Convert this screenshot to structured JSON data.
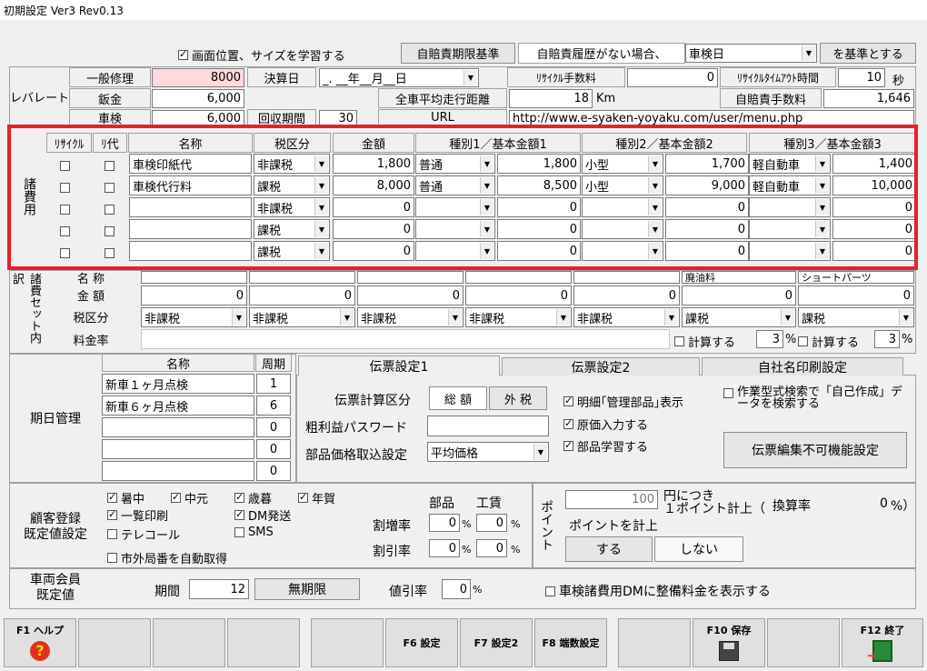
{
  "window": {
    "title": "初期設定 Ver3 Rev0.13"
  },
  "top": {
    "learn_checkbox": "画面位置、サイズを学習する",
    "jibai_button": "自賠責期限基準",
    "jibai_cond": "自賠責履歴がない場合、",
    "jibai_select": "車検日",
    "jibai_suffix": "を基準とする"
  },
  "rate": {
    "label": "レバレート",
    "rows": [
      {
        "name": "一般修理",
        "value": "8000"
      },
      {
        "name": "鈑金",
        "value": "6,000"
      },
      {
        "name": "車検",
        "value": "6,000"
      }
    ],
    "kessan_label": "決算日",
    "kessan_value": "_. __年__月__日",
    "kaishu_label": "回収期間",
    "kaishu_value": "30",
    "recycle_fee_label": "ﾘｻｲｸﾙ手数料",
    "recycle_fee_value": "0",
    "recycle_timeout_label": "ﾘｻｲｸﾙﾀｲﾑｱｳﾄ時間",
    "recycle_timeout_value": "10",
    "recycle_timeout_unit": "秒",
    "mileage_label": "全車平均走行距離",
    "mileage_value": "18",
    "mileage_unit": "Km",
    "jibai_fee_label": "自賠責手数料",
    "jibai_fee_value": "1,646",
    "url_label": "URL",
    "url_value": "http://www.e-syaken-yoyaku.com/user/menu.php"
  },
  "fees": {
    "side_label": "諸費用",
    "headers": [
      "ﾘｻｲｸﾙ",
      "ﾘ代",
      "名称",
      "税区分",
      "金額",
      "種別1／基本金額1",
      "種別2／基本金額2",
      "種別3／基本金額3"
    ],
    "rows": [
      {
        "name": "車検印紙代",
        "tax": "非課税",
        "amount": "1,800",
        "t1": "普通",
        "a1": "1,800",
        "t2": "小型",
        "a2": "1,700",
        "t3": "軽自動車",
        "a3": "1,400"
      },
      {
        "name": "車検代行料",
        "tax": "課税",
        "amount": "8,000",
        "t1": "普通",
        "a1": "8,500",
        "t2": "小型",
        "a2": "9,000",
        "t3": "軽自動車",
        "a3": "10,000"
      },
      {
        "name": "",
        "tax": "非課税",
        "amount": "0",
        "t1": "",
        "a1": "0",
        "t2": "",
        "a2": "0",
        "t3": "",
        "a3": "0"
      },
      {
        "name": "",
        "tax": "課税",
        "amount": "0",
        "t1": "",
        "a1": "0",
        "t2": "",
        "a2": "0",
        "t3": "",
        "a3": "0"
      },
      {
        "name": "",
        "tax": "課税",
        "amount": "0",
        "t1": "",
        "a1": "0",
        "t2": "",
        "a2": "0",
        "t3": "",
        "a3": "0"
      }
    ]
  },
  "set": {
    "side_label": "諸費セット内訳",
    "name_label": "名 称",
    "amount_label": "金 額",
    "tax_label": "税区分",
    "rate_label": "料金率",
    "names": [
      "",
      "",
      "",
      "",
      "",
      "",
      "",
      "ショートパーツ"
    ],
    "extra_name": "廃油料",
    "amounts": [
      "0",
      "0",
      "0",
      "0",
      "0",
      "0",
      "0"
    ],
    "taxes": [
      "非課税",
      "非課税",
      "非課税",
      "非課税",
      "非課税",
      "課税",
      "課税"
    ],
    "calc1": "計算する",
    "calc1_val": "3",
    "calc2": "計算する",
    "calc2_val": "3",
    "pct": "%"
  },
  "kijitsu": {
    "label": "期日管理",
    "name_header": "名称",
    "period_header": "周期",
    "rows": [
      {
        "name": "新車１ヶ月点検",
        "period": "1"
      },
      {
        "name": "新車６ヶ月点検",
        "period": "6"
      },
      {
        "name": "",
        "period": "0"
      },
      {
        "name": "",
        "period": "0"
      },
      {
        "name": "",
        "period": "0"
      }
    ]
  },
  "tabs": {
    "t1": "伝票設定1",
    "t2": "伝票設定2",
    "t3": "自社名印刷設定"
  },
  "denpyo": {
    "calc_label": "伝票計算区分",
    "calc_opt1": "総 額",
    "calc_opt2": "外 税",
    "pw_label": "粗利益パスワード",
    "parts_label": "部品価格取込設定",
    "parts_value": "平均価格",
    "cb1": "明細｢管理部品｣表示",
    "cb2": "原価入力する",
    "cb3": "部品学習する",
    "cb4": "作業型式検索で「自己作成」データを検索する",
    "edit_btn": "伝票編集不可機能設定"
  },
  "customer": {
    "label": "顧客登録\n既定値設定",
    "cbs": [
      {
        "t": "暑中",
        "on": true
      },
      {
        "t": "中元",
        "on": true
      },
      {
        "t": "歳暮",
        "on": true
      },
      {
        "t": "年賀",
        "on": true
      },
      {
        "t": "一覧印刷",
        "on": true
      },
      {
        "t": "DM発送",
        "on": true
      },
      {
        "t": "テレコール",
        "on": false
      },
      {
        "t": "SMS",
        "on": false
      }
    ],
    "auto": "市外局番を自動取得",
    "parts": "部品",
    "labor": "工賃",
    "surcharge": "割増率",
    "discount": "割引率",
    "v1": "0",
    "v2": "0",
    "v3": "0",
    "v4": "0",
    "pct": "%"
  },
  "point": {
    "label": "ポイント",
    "value": "100",
    "per": "円につき",
    "per2": "１ポイント計上（",
    "conv_label": "換算率",
    "conv_value": "0",
    "conv_suffix": "%）",
    "calc_label": "ポイントを計上",
    "yes": "する",
    "no": "しない"
  },
  "member": {
    "label": "車両会員\n既定値",
    "period_label": "期間",
    "period_value": "12",
    "unlimited": "無期限",
    "disc_label": "値引率",
    "disc_value": "0",
    "pct": "%",
    "dm_cb": "車検諸費用DMに整備料金を表示する"
  },
  "fkeys": {
    "f1": "F1 ヘルプ",
    "f6": "F6 設定",
    "f7": "F7 設定2",
    "f8": "F8 端数設定",
    "f10": "F10 保存",
    "f12": "F12 終了"
  },
  "colors": {
    "highlight": "#e8202a",
    "pink": "#ffd9dc"
  }
}
